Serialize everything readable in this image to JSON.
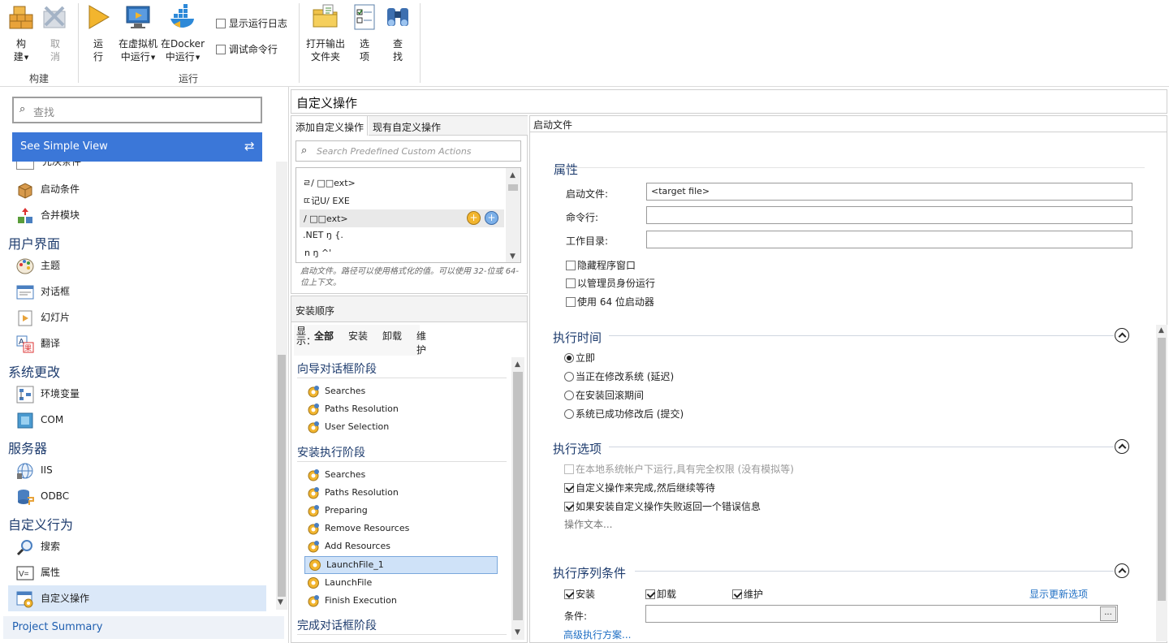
{
  "ribbon": {
    "build": {
      "label1": "构",
      "label2": "建"
    },
    "cancel": {
      "label1": "取",
      "label2": "消"
    },
    "run": {
      "label1": "运",
      "label2": "行"
    },
    "run_vm": {
      "label1": "在虚拟机",
      "label2": "中运行"
    },
    "run_docker": {
      "label1": "在Docker",
      "label2": "中运行"
    },
    "show_log": "显示运行日志",
    "debug_cmd": "调试命令行",
    "open_output": {
      "label1": "打开输出",
      "label2": "文件夹"
    },
    "options": {
      "label1": "选",
      "label2": "项"
    },
    "find": {
      "label1": "查",
      "label2": "找"
    },
    "group_build": "构建",
    "group_run": "运行"
  },
  "left": {
    "search_placeholder": "查找",
    "simple_view": "See Simple View",
    "partial_item": "先决条件",
    "items_a": [
      {
        "label": "启动条件",
        "icon": "box-icon"
      },
      {
        "label": "合并模块",
        "icon": "merge-module-icon"
      }
    ],
    "sec_ui": "用户界面",
    "items_ui": [
      {
        "label": "主题",
        "icon": "palette-icon"
      },
      {
        "label": "对话框",
        "icon": "dialog-icon"
      },
      {
        "label": "幻灯片",
        "icon": "slideshow-icon"
      },
      {
        "label": "翻译",
        "icon": "translate-icon"
      }
    ],
    "sec_sys": "系统更改",
    "items_sys": [
      {
        "label": "环境变量",
        "icon": "env-vars-icon"
      },
      {
        "label": "COM",
        "icon": "com-icon"
      }
    ],
    "sec_srv": "服务器",
    "items_srv": [
      {
        "label": "IIS",
        "icon": "iis-icon"
      },
      {
        "label": "ODBC",
        "icon": "odbc-icon"
      }
    ],
    "sec_custom": "自定义行为",
    "items_custom": [
      {
        "label": "搜索",
        "icon": "search-icon"
      },
      {
        "label": "属性",
        "icon": "property-icon"
      },
      {
        "label": "自定义操作",
        "icon": "custom-action-icon"
      }
    ],
    "project_summary": "Project Summary"
  },
  "page_title": "自定义操作",
  "mid": {
    "tab_add": "添加自定义操作",
    "tab_existing": "现有自定义操作",
    "search_placeholder": "Search Predefined Custom Actions",
    "predefined": [
      "ㄹ/ □□ext>",
      "ㄸ记U/ EXE",
      "/ □□ext>",
      ".NET ŋ {.",
      "n ŋ ^'"
    ],
    "desc": "启动文件。路径可以使用格式化的值。可以使用 32-位或 64-位上下文。",
    "sequence_title": "安装顺序",
    "show_label": "显示：",
    "filters": [
      "全部",
      "安装",
      "卸载",
      "维护"
    ],
    "stage_wizard": "向导对话框阶段",
    "wizard_items": [
      "Searches",
      "Paths Resolution",
      "User Selection"
    ],
    "stage_install": "安装执行阶段",
    "install_items": [
      "Searches",
      "Paths Resolution",
      "Preparing",
      "Remove Resources",
      "Add Resources",
      "LaunchFile_1",
      "LaunchFile",
      "Finish Execution"
    ],
    "stage_finish": "完成对话框阶段"
  },
  "right": {
    "header": "启动文件",
    "sec_props": "属性",
    "launch_file_label": "启动文件:",
    "launch_file_value": "<target file>",
    "cmdline_label": "命令行:",
    "workdir_label": "工作目录:",
    "hide_window": "隐藏程序窗口",
    "run_as_admin": "以管理员身份运行",
    "use_64": "使用 64 位启动器",
    "sec_exec_time": "执行时间",
    "radios": [
      "立即",
      "当正在修改系统 (延迟)",
      "在安装回滚期间",
      "系统已成功修改后 (提交)"
    ],
    "sec_exec_opts": "执行选项",
    "opt_local_system": "在本地系统帐户下运行,具有完全权限 (没有模拟等)",
    "opt_wait": "自定义操作来完成,然后继续等待",
    "opt_fail": "如果安装自定义操作失败返回一个错误信息",
    "action_text": "操作文本...",
    "sec_seq_cond": "执行序列条件",
    "cond_install": "安装",
    "cond_uninstall": "卸载",
    "cond_maintenance": "维护",
    "show_update": "显示更新选项",
    "condition_label": "条件:",
    "browse": "...",
    "advanced": "高级执行方案..."
  },
  "colors": {
    "accent": "#3b77d8",
    "section": "#1e3c6e",
    "selected": "#dbe8f8",
    "link": "#1f6fc4"
  }
}
